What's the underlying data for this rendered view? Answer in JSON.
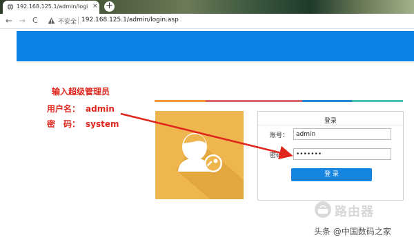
{
  "browser": {
    "tab_title": "192.168.125.1/admin/login.asp",
    "tab_close": "×",
    "new_tab": "+",
    "back": "←",
    "forward": "→",
    "reload": "C",
    "insecure_label": "不安全",
    "url": "192.168.125.1/admin/login.asp"
  },
  "annotation": {
    "line1": "输入超级管理员",
    "line2_label": "用户名：",
    "line2_value": "admin",
    "line3_label": "密　码：",
    "line3_value": "system"
  },
  "login": {
    "title": "登录",
    "username_label": "账号：",
    "username_value": "admin",
    "password_label": "密码：",
    "password_value": "•••••••",
    "submit_label": "登 录"
  },
  "stripe_colors": [
    "#ef9a3a",
    "#d96a6a",
    "#2e86d6",
    "#4dbfae"
  ],
  "colors": {
    "header": "#0a84e8",
    "panel": "#efb54e",
    "button": "#1685e0",
    "annotation": "#e0251d"
  },
  "watermark": {
    "brand": "路由器",
    "source": "头条 @中国数码之家"
  }
}
